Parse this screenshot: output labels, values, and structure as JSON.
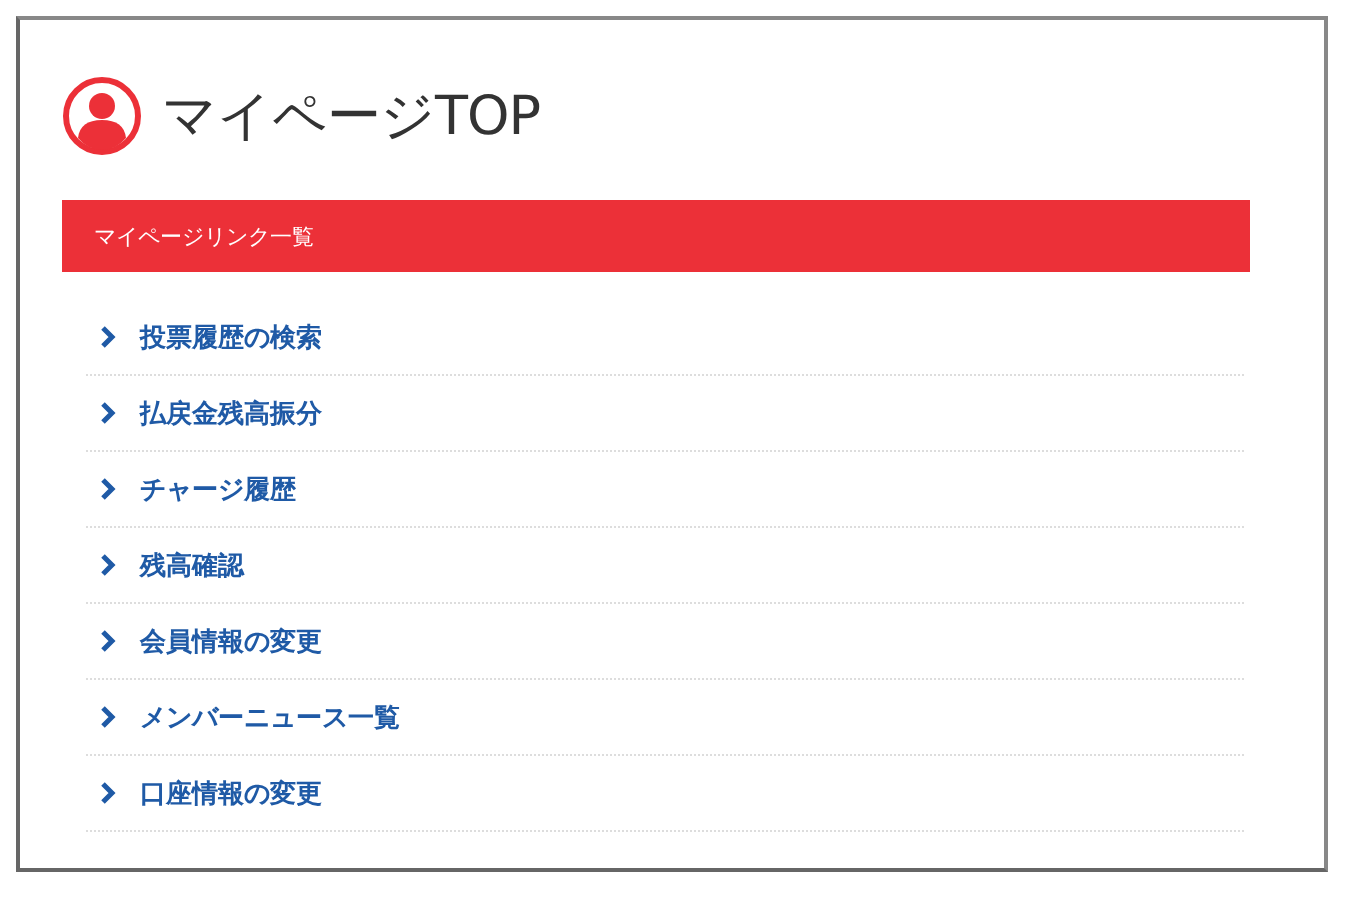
{
  "page_title": "マイページTOP",
  "section": {
    "title": "マイページリンク一覧"
  },
  "links": [
    {
      "label": "投票履歴の検索"
    },
    {
      "label": "払戻金残高振分"
    },
    {
      "label": "チャージ履歴"
    },
    {
      "label": "残高確認"
    },
    {
      "label": "会員情報の変更"
    },
    {
      "label": "メンバーニュース一覧"
    },
    {
      "label": "口座情報の変更"
    }
  ]
}
